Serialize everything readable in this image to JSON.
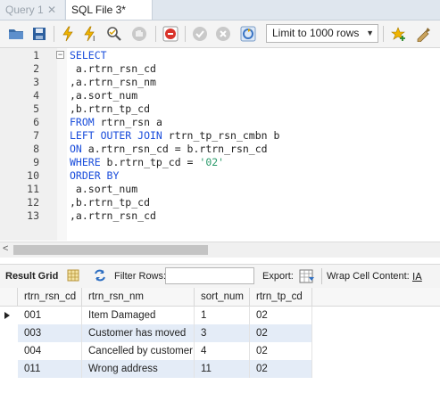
{
  "tabs": [
    {
      "label": "Query 1",
      "close": "✕"
    },
    {
      "label": "SQL File 3*"
    }
  ],
  "toolbar": {
    "icons": [
      "folder-open-icon",
      "save-icon",
      "execute-icon",
      "execute-current-icon",
      "explain-icon",
      "stop-icon",
      "toggle-error-icon",
      "commit-icon",
      "rollback-icon",
      "autocommit-icon",
      "add-snippet-icon",
      "beautify-icon"
    ],
    "limit_label": "Limit to 1000 rows"
  },
  "editor": {
    "lines": [
      {
        "n": "1",
        "parts": [
          {
            "t": "SELECT",
            "c": "kw"
          }
        ]
      },
      {
        "n": "2",
        "parts": [
          {
            "t": " a.rtrn_rsn_cd",
            "c": ""
          }
        ]
      },
      {
        "n": "3",
        "parts": [
          {
            "t": ",a.rtrn_rsn_nm",
            "c": ""
          }
        ]
      },
      {
        "n": "4",
        "parts": [
          {
            "t": ",a.sort_num",
            "c": ""
          }
        ]
      },
      {
        "n": "5",
        "parts": [
          {
            "t": ",b.rtrn_tp_cd",
            "c": ""
          }
        ]
      },
      {
        "n": "6",
        "parts": [
          {
            "t": "FROM",
            "c": "kw"
          },
          {
            "t": " rtrn_rsn a",
            "c": ""
          }
        ]
      },
      {
        "n": "7",
        "parts": [
          {
            "t": "LEFT OUTER JOIN",
            "c": "kw"
          },
          {
            "t": " rtrn_tp_rsn_cmbn b",
            "c": ""
          }
        ]
      },
      {
        "n": "8",
        "parts": [
          {
            "t": "ON",
            "c": "kw"
          },
          {
            "t": " a.rtrn_rsn_cd = b.rtrn_rsn_cd",
            "c": ""
          }
        ]
      },
      {
        "n": "9",
        "parts": [
          {
            "t": "WHERE",
            "c": "kw"
          },
          {
            "t": " b.rtrn_tp_cd = ",
            "c": ""
          },
          {
            "t": "'02'",
            "c": "str"
          }
        ]
      },
      {
        "n": "10",
        "parts": [
          {
            "t": "ORDER BY",
            "c": "kw"
          }
        ]
      },
      {
        "n": "11",
        "parts": [
          {
            "t": " a.sort_num",
            "c": ""
          }
        ]
      },
      {
        "n": "12",
        "parts": [
          {
            "t": ",b.rtrn_tp_cd",
            "c": ""
          }
        ]
      },
      {
        "n": "13",
        "parts": [
          {
            "t": ",a.rtrn_rsn_cd",
            "c": ""
          }
        ]
      }
    ]
  },
  "result_toolbar": {
    "result_grid": "Result Grid",
    "filter_rows": "Filter Rows:",
    "filter_value": "",
    "export": "Export:",
    "wrap": "Wrap Cell Content:",
    "wrap_icon": "IA"
  },
  "grid": {
    "columns": [
      "rtrn_rsn_cd",
      "rtrn_rsn_nm",
      "sort_num",
      "rtrn_tp_cd"
    ],
    "rows": [
      [
        "001",
        "Item Damaged",
        "1",
        "02"
      ],
      [
        "003",
        "Customer has moved",
        "3",
        "02"
      ],
      [
        "004",
        "Cancelled by customer",
        "4",
        "02"
      ],
      [
        "011",
        "Wrong address",
        "11",
        "02"
      ]
    ]
  },
  "colors": {
    "keyword": "#1a4ddb",
    "string": "#2a9a6a",
    "alt_row": "#e4ecf7"
  }
}
